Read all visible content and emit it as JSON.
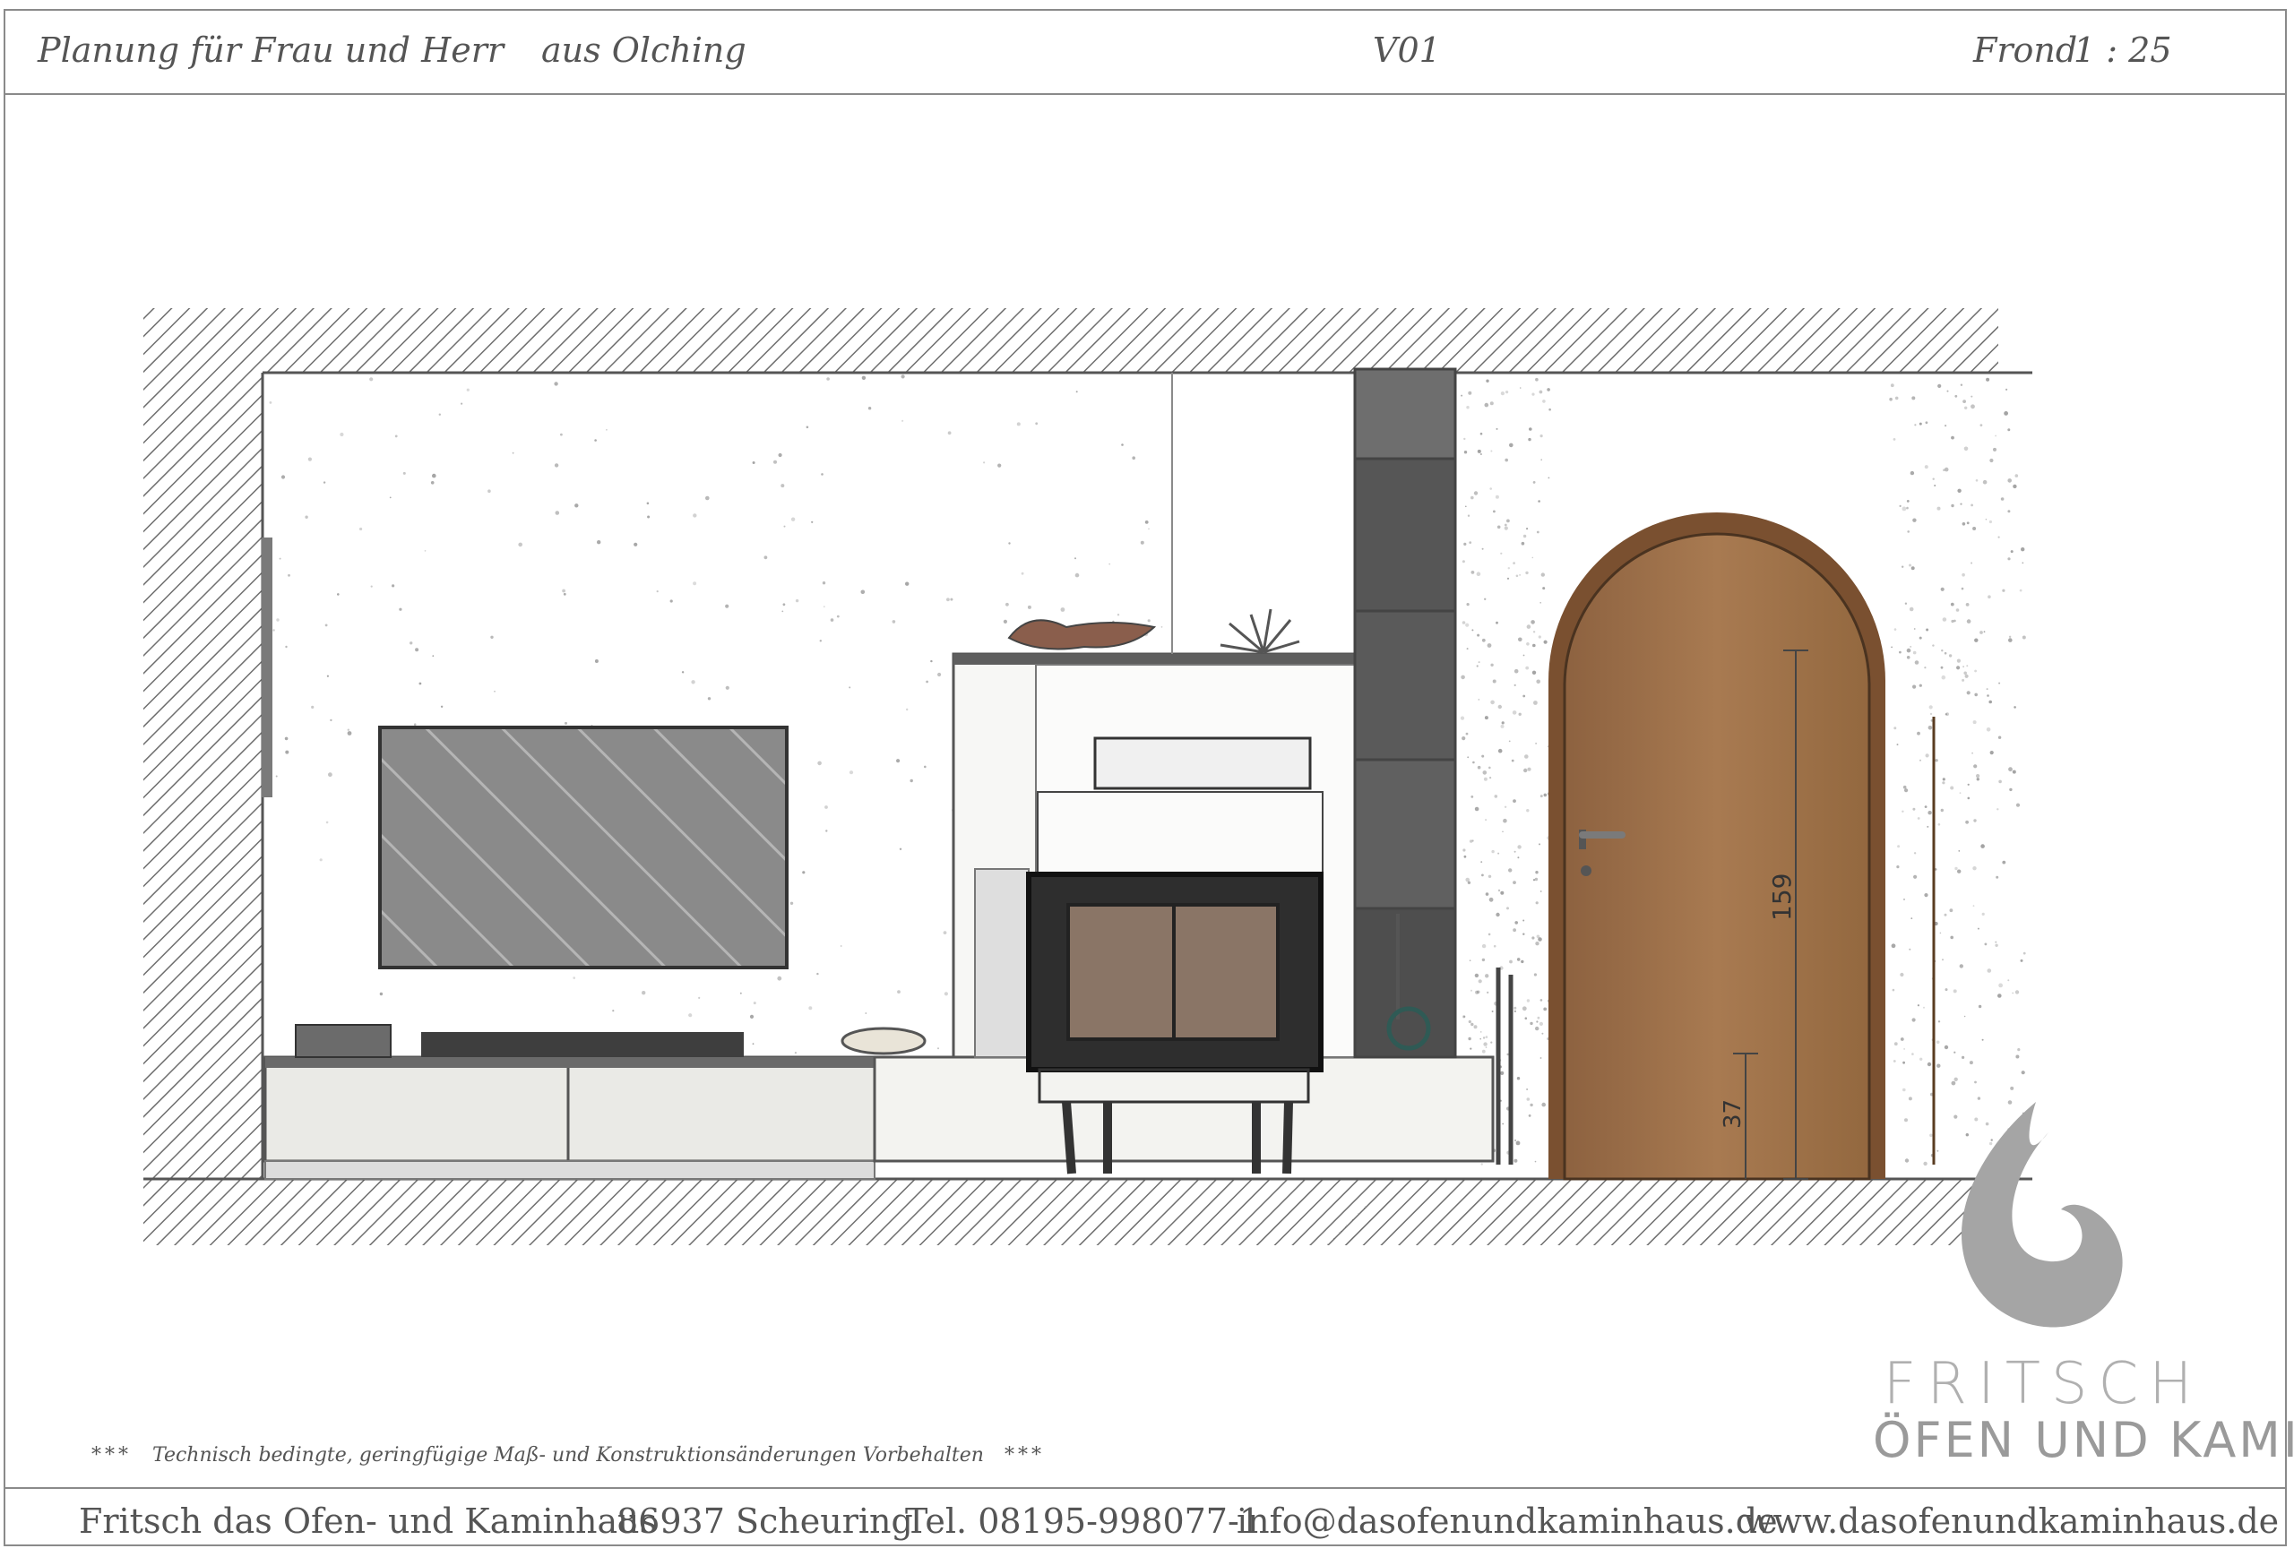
{
  "header": {
    "planning": "Planung für Frau und Herr",
    "location": "aus Olching",
    "version": "V01",
    "view": "Frond",
    "scale": "1 : 25"
  },
  "dimensions": {
    "door_height": "159",
    "step_height": "37"
  },
  "disclaimer": {
    "stars": "***",
    "text": "Technisch bedingte, geringfügige Maß- und Konstruktionsänderungen Vorbehalten"
  },
  "brand": {
    "line1": "FRITSCH",
    "line2": "ÖFEN UND KAMINE"
  },
  "footer": {
    "company": "Fritsch das Ofen- und Kaminhaus",
    "city": "86937 Scheuring",
    "phone": "Tel. 08195-998077-1",
    "email": "info@dasofenundkaminhaus.de",
    "web": "www.dasofenundkaminhaus.de"
  },
  "colors": {
    "wall_hatch": "#6e6e6e",
    "door_wood": "#9c6e45",
    "tile_dark": "#4b4b4b",
    "tv_glass": "#7a7a7a"
  }
}
